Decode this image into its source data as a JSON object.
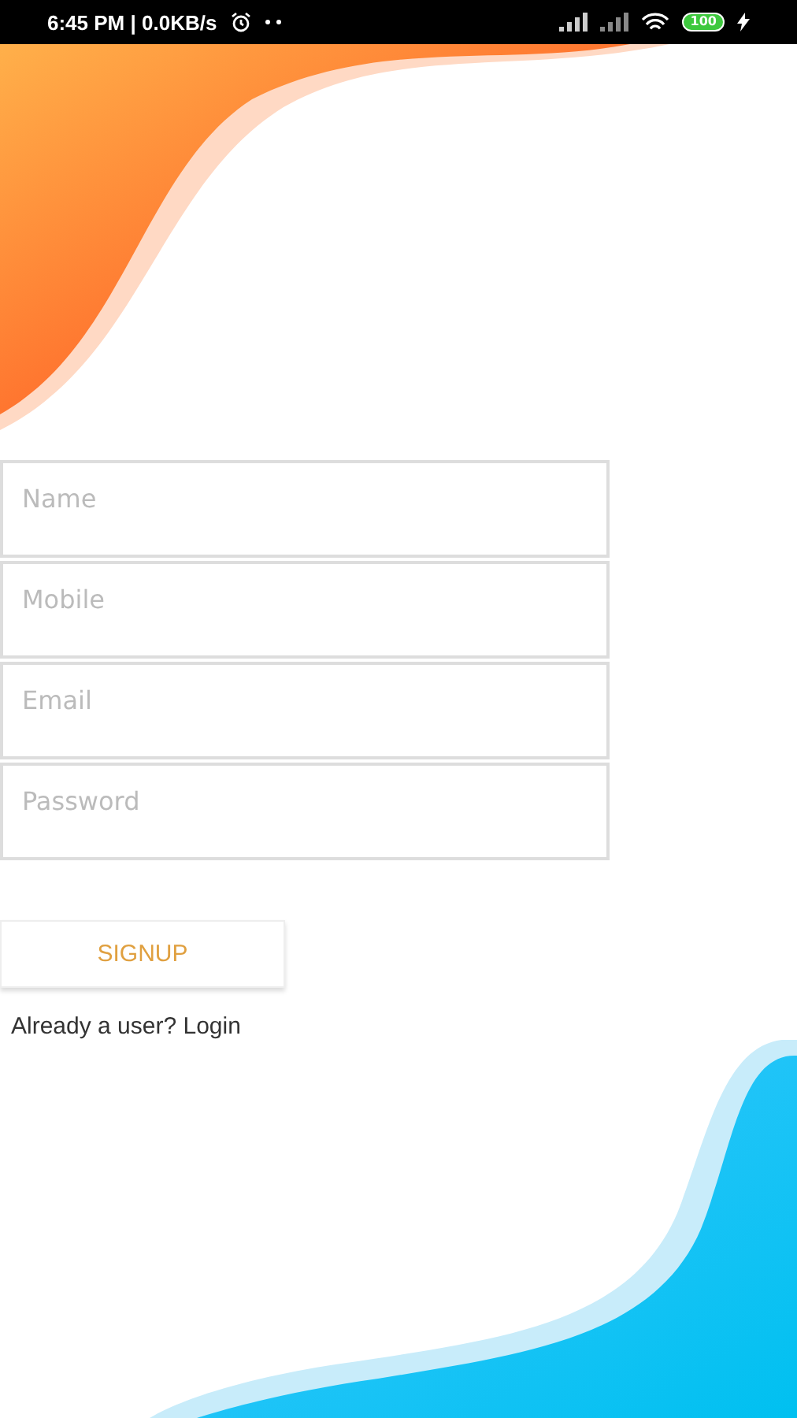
{
  "status_bar": {
    "time": "6:45 PM | 0.0KB/s",
    "battery": "100"
  },
  "form": {
    "fields": [
      {
        "placeholder": "Name"
      },
      {
        "placeholder": "Mobile"
      },
      {
        "placeholder": "Email"
      },
      {
        "placeholder": "Password"
      }
    ],
    "submit": "SIGNUP",
    "login_link": "Already a user? Login"
  }
}
